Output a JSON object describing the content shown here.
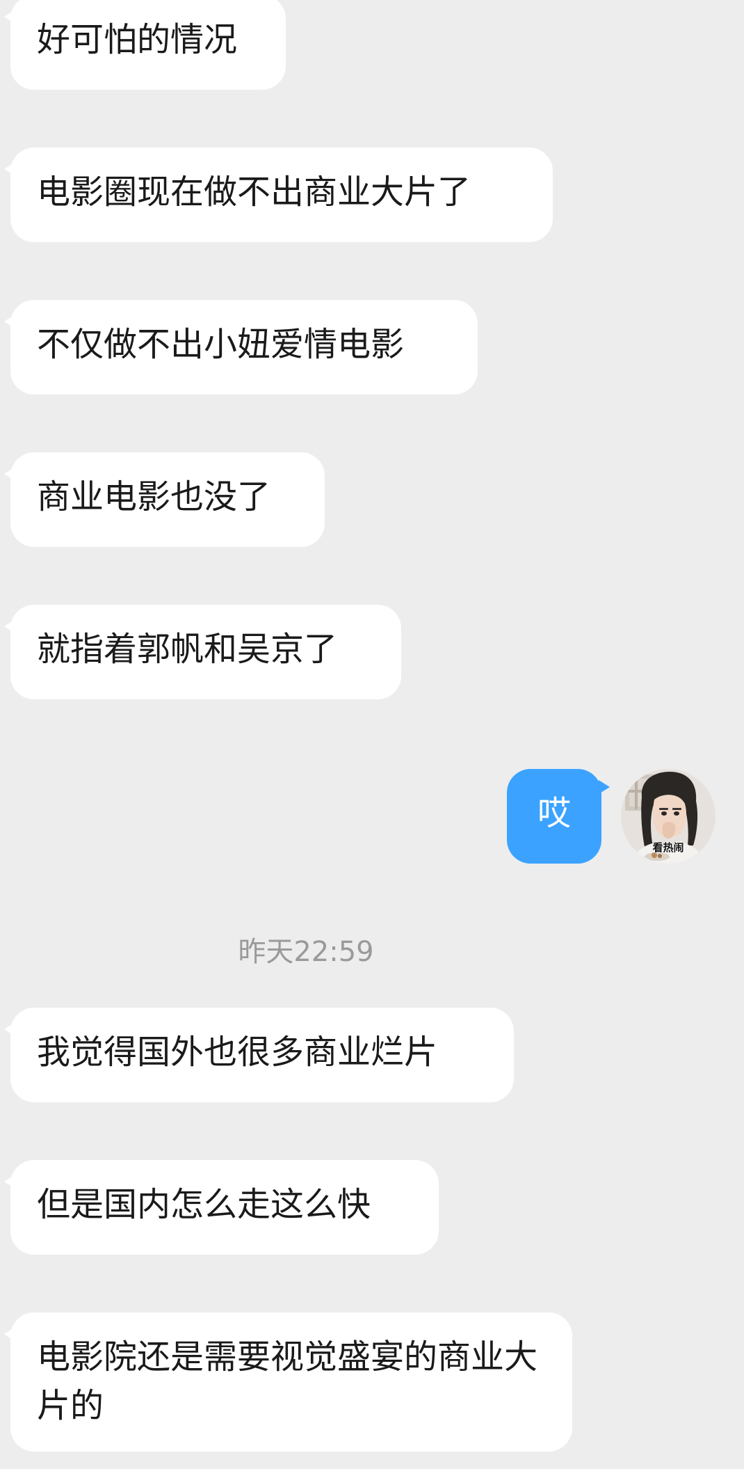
{
  "messages": [
    {
      "side": "in",
      "text": "好可怕的情况"
    },
    {
      "side": "in",
      "text": "电影圈现在做不出商业大片了"
    },
    {
      "side": "in",
      "text": "不仅做不出小妞爱情电影"
    },
    {
      "side": "in",
      "text": "商业电影也没了"
    },
    {
      "side": "in",
      "text": "就指着郭帆和吴京了"
    },
    {
      "side": "out",
      "text": "哎"
    },
    {
      "side": "in",
      "text": "我觉得国外也很多商业烂片"
    },
    {
      "side": "in",
      "text": "但是国内怎么走这么快"
    },
    {
      "side": "in",
      "text": "电影院还是需要视觉盛宴的商业大片的"
    }
  ],
  "timestamp": "昨天22:59",
  "avatar": {
    "caption": "看热闹",
    "icon": "user-avatar-icon"
  },
  "colors": {
    "background": "#ededed",
    "incoming_bubble": "#ffffff",
    "outgoing_bubble": "#3ba3ff",
    "timestamp_text": "#9a9a9a"
  }
}
